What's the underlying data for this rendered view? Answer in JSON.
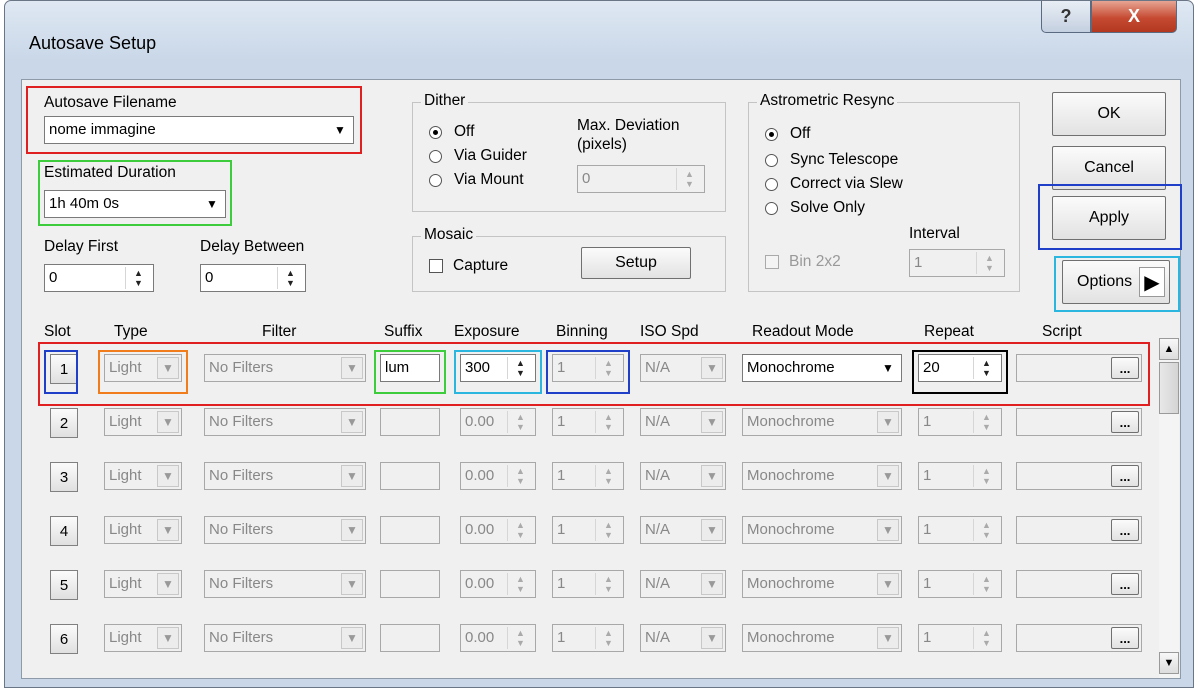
{
  "window": {
    "title": "Autosave Setup",
    "help_glyph": "?",
    "close_glyph": "X"
  },
  "autosave": {
    "label": "Autosave Filename",
    "value": "nome immagine"
  },
  "duration": {
    "label": "Estimated Duration",
    "value": "1h 40m 0s"
  },
  "delay_first": {
    "label": "Delay First",
    "value": "0"
  },
  "delay_between": {
    "label": "Delay Between",
    "value": "0"
  },
  "dither": {
    "label": "Dither",
    "options": [
      "Off",
      "Via Guider",
      "Via Mount"
    ],
    "selected": "Off",
    "max_dev_label_1": "Max. Deviation",
    "max_dev_label_2": "(pixels)",
    "max_dev_value": "0"
  },
  "mosaic": {
    "label": "Mosaic",
    "capture_label": "Capture",
    "setup_label": "Setup"
  },
  "astrometric": {
    "label": "Astrometric Resync",
    "options": [
      "Off",
      "Sync Telescope",
      "Correct via Slew",
      "Solve Only"
    ],
    "selected": "Off",
    "bin_label": "Bin 2x2",
    "interval_label": "Interval",
    "interval_value": "1"
  },
  "buttons": {
    "ok": "OK",
    "cancel": "Cancel",
    "apply": "Apply",
    "options": "Options"
  },
  "columns": [
    "Slot",
    "Type",
    "Filter",
    "Suffix",
    "Exposure",
    "Binning",
    "ISO Spd",
    "Readout Mode",
    "Repeat",
    "Script"
  ],
  "rows": [
    {
      "slot": "1",
      "type": "Light",
      "filter": "No Filters",
      "suffix": "lum",
      "exposure": "300",
      "binning": "1",
      "iso": "N/A",
      "readout": "Monochrome",
      "repeat": "20",
      "script": "...",
      "active": true
    },
    {
      "slot": "2",
      "type": "Light",
      "filter": "No Filters",
      "suffix": "",
      "exposure": "0.00",
      "binning": "1",
      "iso": "N/A",
      "readout": "Monochrome",
      "repeat": "1",
      "script": "...",
      "active": false
    },
    {
      "slot": "3",
      "type": "Light",
      "filter": "No Filters",
      "suffix": "",
      "exposure": "0.00",
      "binning": "1",
      "iso": "N/A",
      "readout": "Monochrome",
      "repeat": "1",
      "script": "...",
      "active": false
    },
    {
      "slot": "4",
      "type": "Light",
      "filter": "No Filters",
      "suffix": "",
      "exposure": "0.00",
      "binning": "1",
      "iso": "N/A",
      "readout": "Monochrome",
      "repeat": "1",
      "script": "...",
      "active": false
    },
    {
      "slot": "5",
      "type": "Light",
      "filter": "No Filters",
      "suffix": "",
      "exposure": "0.00",
      "binning": "1",
      "iso": "N/A",
      "readout": "Monochrome",
      "repeat": "1",
      "script": "...",
      "active": false
    },
    {
      "slot": "6",
      "type": "Light",
      "filter": "No Filters",
      "suffix": "",
      "exposure": "0.00",
      "binning": "1",
      "iso": "N/A",
      "readout": "Monochrome",
      "repeat": "1",
      "script": "...",
      "active": false
    }
  ],
  "highlight_colors": {
    "red": "#e02020",
    "green": "#3ccc3c",
    "blue": "#1f3fc8",
    "cyan": "#2bb6e0",
    "orange": "#f07c1c",
    "black": "#000000"
  }
}
